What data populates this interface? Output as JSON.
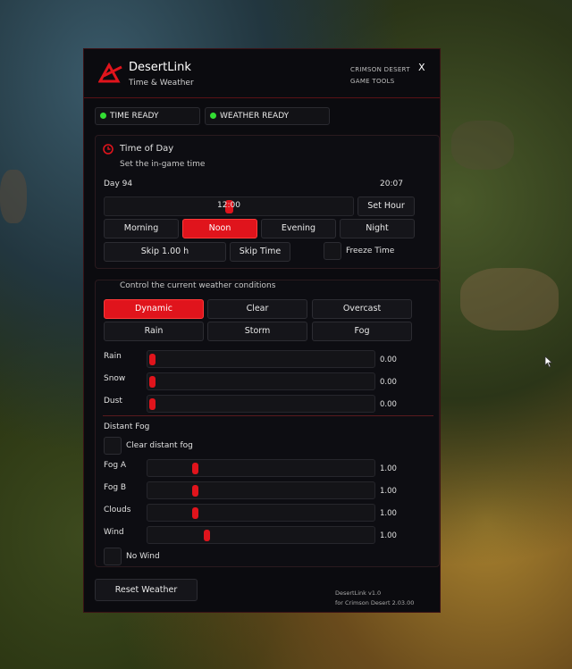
{
  "app": {
    "name": "DesertLink",
    "subtitle": "Time & Weather",
    "brand_line1": "CRIMSON DESERT",
    "brand_line2": "GAME TOOLS",
    "close_label": "X"
  },
  "status": [
    {
      "label": "TIME READY",
      "color": "#33dd33"
    },
    {
      "label": "WEATHER READY",
      "color": "#33dd33"
    }
  ],
  "time": {
    "title": "Time of Day",
    "subtitle": "Set the in-game time",
    "day": "Day 94",
    "clock": "20:07",
    "hour_value": "12:00",
    "hour_fraction": 0.5,
    "set_hour": "Set Hour",
    "presets": [
      "Morning",
      "Noon",
      "Evening",
      "Night"
    ],
    "active_preset": "Noon",
    "skip_amount": "Skip 1.00 h",
    "skip_time": "Skip Time",
    "freeze_time": "Freeze Time"
  },
  "weather": {
    "subtitle": "Control the current weather conditions",
    "presets": [
      "Dynamic",
      "Clear",
      "Overcast",
      "Rain",
      "Storm",
      "Fog"
    ],
    "active_preset": "Dynamic",
    "sliders": [
      {
        "label": "Rain",
        "value": "0.00",
        "fraction": 0.0
      },
      {
        "label": "Snow",
        "value": "0.00",
        "fraction": 0.0
      },
      {
        "label": "Dust",
        "value": "0.00",
        "fraction": 0.0
      }
    ],
    "distant_fog_title": "Distant Fog",
    "clear_distant_fog": "Clear distant fog",
    "fog_sliders": [
      {
        "label": "Fog A",
        "value": "1.00",
        "fraction": 0.2
      },
      {
        "label": "Fog B",
        "value": "1.00",
        "fraction": 0.2
      },
      {
        "label": "Clouds",
        "value": "1.00",
        "fraction": 0.2
      },
      {
        "label": "Wind",
        "value": "1.00",
        "fraction": 0.25
      }
    ],
    "no_wind": "No Wind",
    "reset": "Reset Weather"
  },
  "footer": {
    "version": "DesertLink  v1.0",
    "target": "for Crimson Desert 2.03.00"
  },
  "colors": {
    "accent": "#e0141c",
    "ready": "#33dd33",
    "panel_bg": "#0b0b0f"
  }
}
